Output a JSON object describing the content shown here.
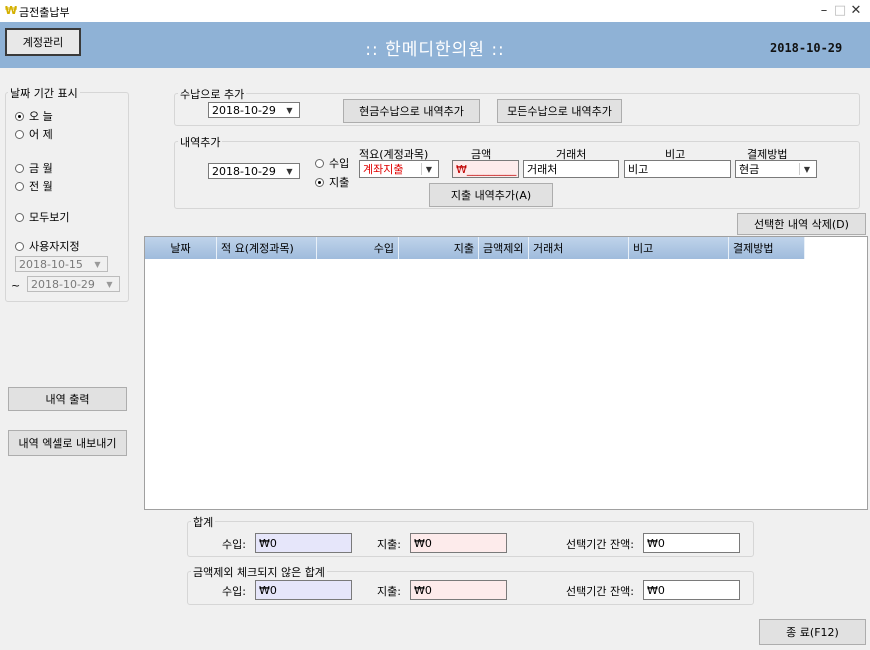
{
  "window": {
    "icon": "₩",
    "title": "금전출납부",
    "minimize": "–",
    "maximize": "□",
    "close": "✕"
  },
  "header": {
    "account_button": "계정관리",
    "title": ":: 한메디한의원 ::",
    "date": "2018-10-29"
  },
  "period": {
    "label": "날짜 기간 표시",
    "options": [
      "오 늘",
      "어 제",
      "금 월",
      "전 월",
      "모두보기",
      "사용자지정"
    ],
    "selected": "오 늘",
    "from": "2018-10-15",
    "tilde": "~",
    "to": "2018-10-29"
  },
  "left_buttons": {
    "print": "내역 출력",
    "export_excel": "내역 엑셀로 내보내기"
  },
  "receipt_add": {
    "label": "수납으로 추가",
    "date": "2018-10-29",
    "cash_button": "현금수납으로 내역추가",
    "all_button": "모든수납으로 내역추가"
  },
  "entry_add": {
    "label": "내역추가",
    "date": "2018-10-29",
    "income_label": "수입",
    "expense_label": "지출",
    "selected": "지출",
    "col_account": "적요(계정과목)",
    "col_amount": "금액",
    "col_vendor": "거래처",
    "col_note": "비고",
    "col_payment": "결제방법",
    "account_value": "계좌지출",
    "amount_value": "₩_________",
    "vendor_value": "거래처",
    "note_value": "비고",
    "payment_value": "현금",
    "submit_button": "지출 내역추가(A)"
  },
  "delete_button": "선택한 내역 삭제(D)",
  "table": {
    "columns": [
      "날짜",
      "적 요(계정과목)",
      "수입",
      "지출",
      "금액제외",
      "거래처",
      "비고",
      "결제방법"
    ],
    "rows": []
  },
  "totals": {
    "label": "합계",
    "income_label": "수입:",
    "income": "₩0",
    "expense_label": "지출:",
    "expense": "₩0",
    "balance_label": "선택기간 잔액:",
    "balance": "₩0"
  },
  "totals_unchecked": {
    "label": "금액제외 체크되지 않은 합계",
    "income_label": "수입:",
    "income": "₩0",
    "expense_label": "지출:",
    "expense": "₩0",
    "balance_label": "선택기간 잔액:",
    "balance": "₩0"
  },
  "close_button": "종 료(F12)",
  "colors": {
    "header_bg": "#8fb2d6",
    "income_field_bg": "#e6e6fa",
    "expense_field_bg": "#fdebeb",
    "account_text": "#e00000"
  }
}
